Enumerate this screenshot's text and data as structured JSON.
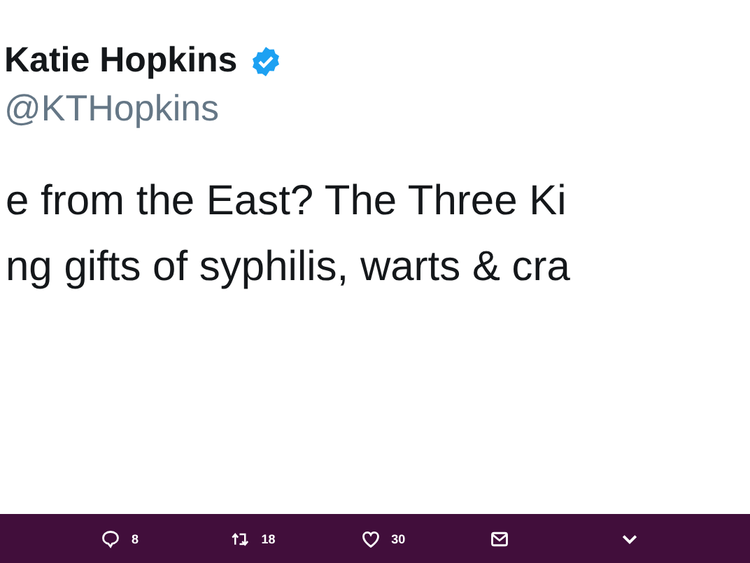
{
  "author": {
    "name": "Katie Hopkins",
    "verified": true,
    "handle": "@KTHopkins"
  },
  "tweet_lines": [
    "e from the East? The Three Ki",
    "ng gifts of syphilis, warts & cra"
  ],
  "actions": [
    {
      "kind": "reply",
      "count": "8"
    },
    {
      "kind": "retweet",
      "count": "18"
    },
    {
      "kind": "like",
      "count": "30"
    },
    {
      "kind": "message"
    },
    {
      "kind": "more"
    }
  ]
}
